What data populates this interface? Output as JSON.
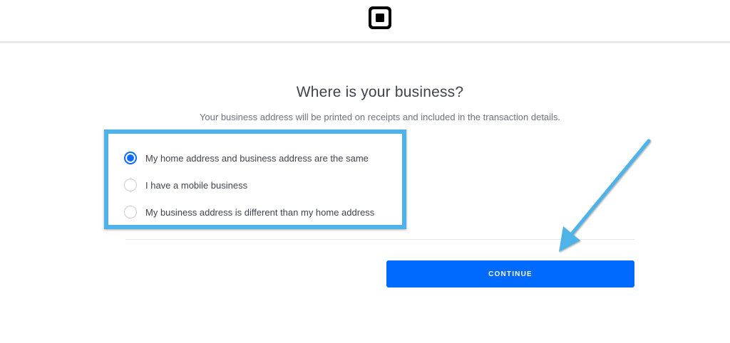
{
  "header": {
    "logo": "square-logo-icon"
  },
  "main": {
    "title": "Where is your business?",
    "subtitle": "Your business address will be printed on receipts and included in the transaction details.",
    "options": [
      {
        "label": "My home address and business address are the same",
        "selected": true
      },
      {
        "label": "I have a mobile business",
        "selected": false
      },
      {
        "label": "My business address is different than my home address",
        "selected": false
      }
    ],
    "continue_label": "CONTINUE"
  },
  "annotations": {
    "highlight_color": "#4fb3e8",
    "arrow_color": "#4fb3e8"
  },
  "colors": {
    "accent": "#006aff",
    "text": "#3e4450",
    "muted": "#6b7280"
  }
}
